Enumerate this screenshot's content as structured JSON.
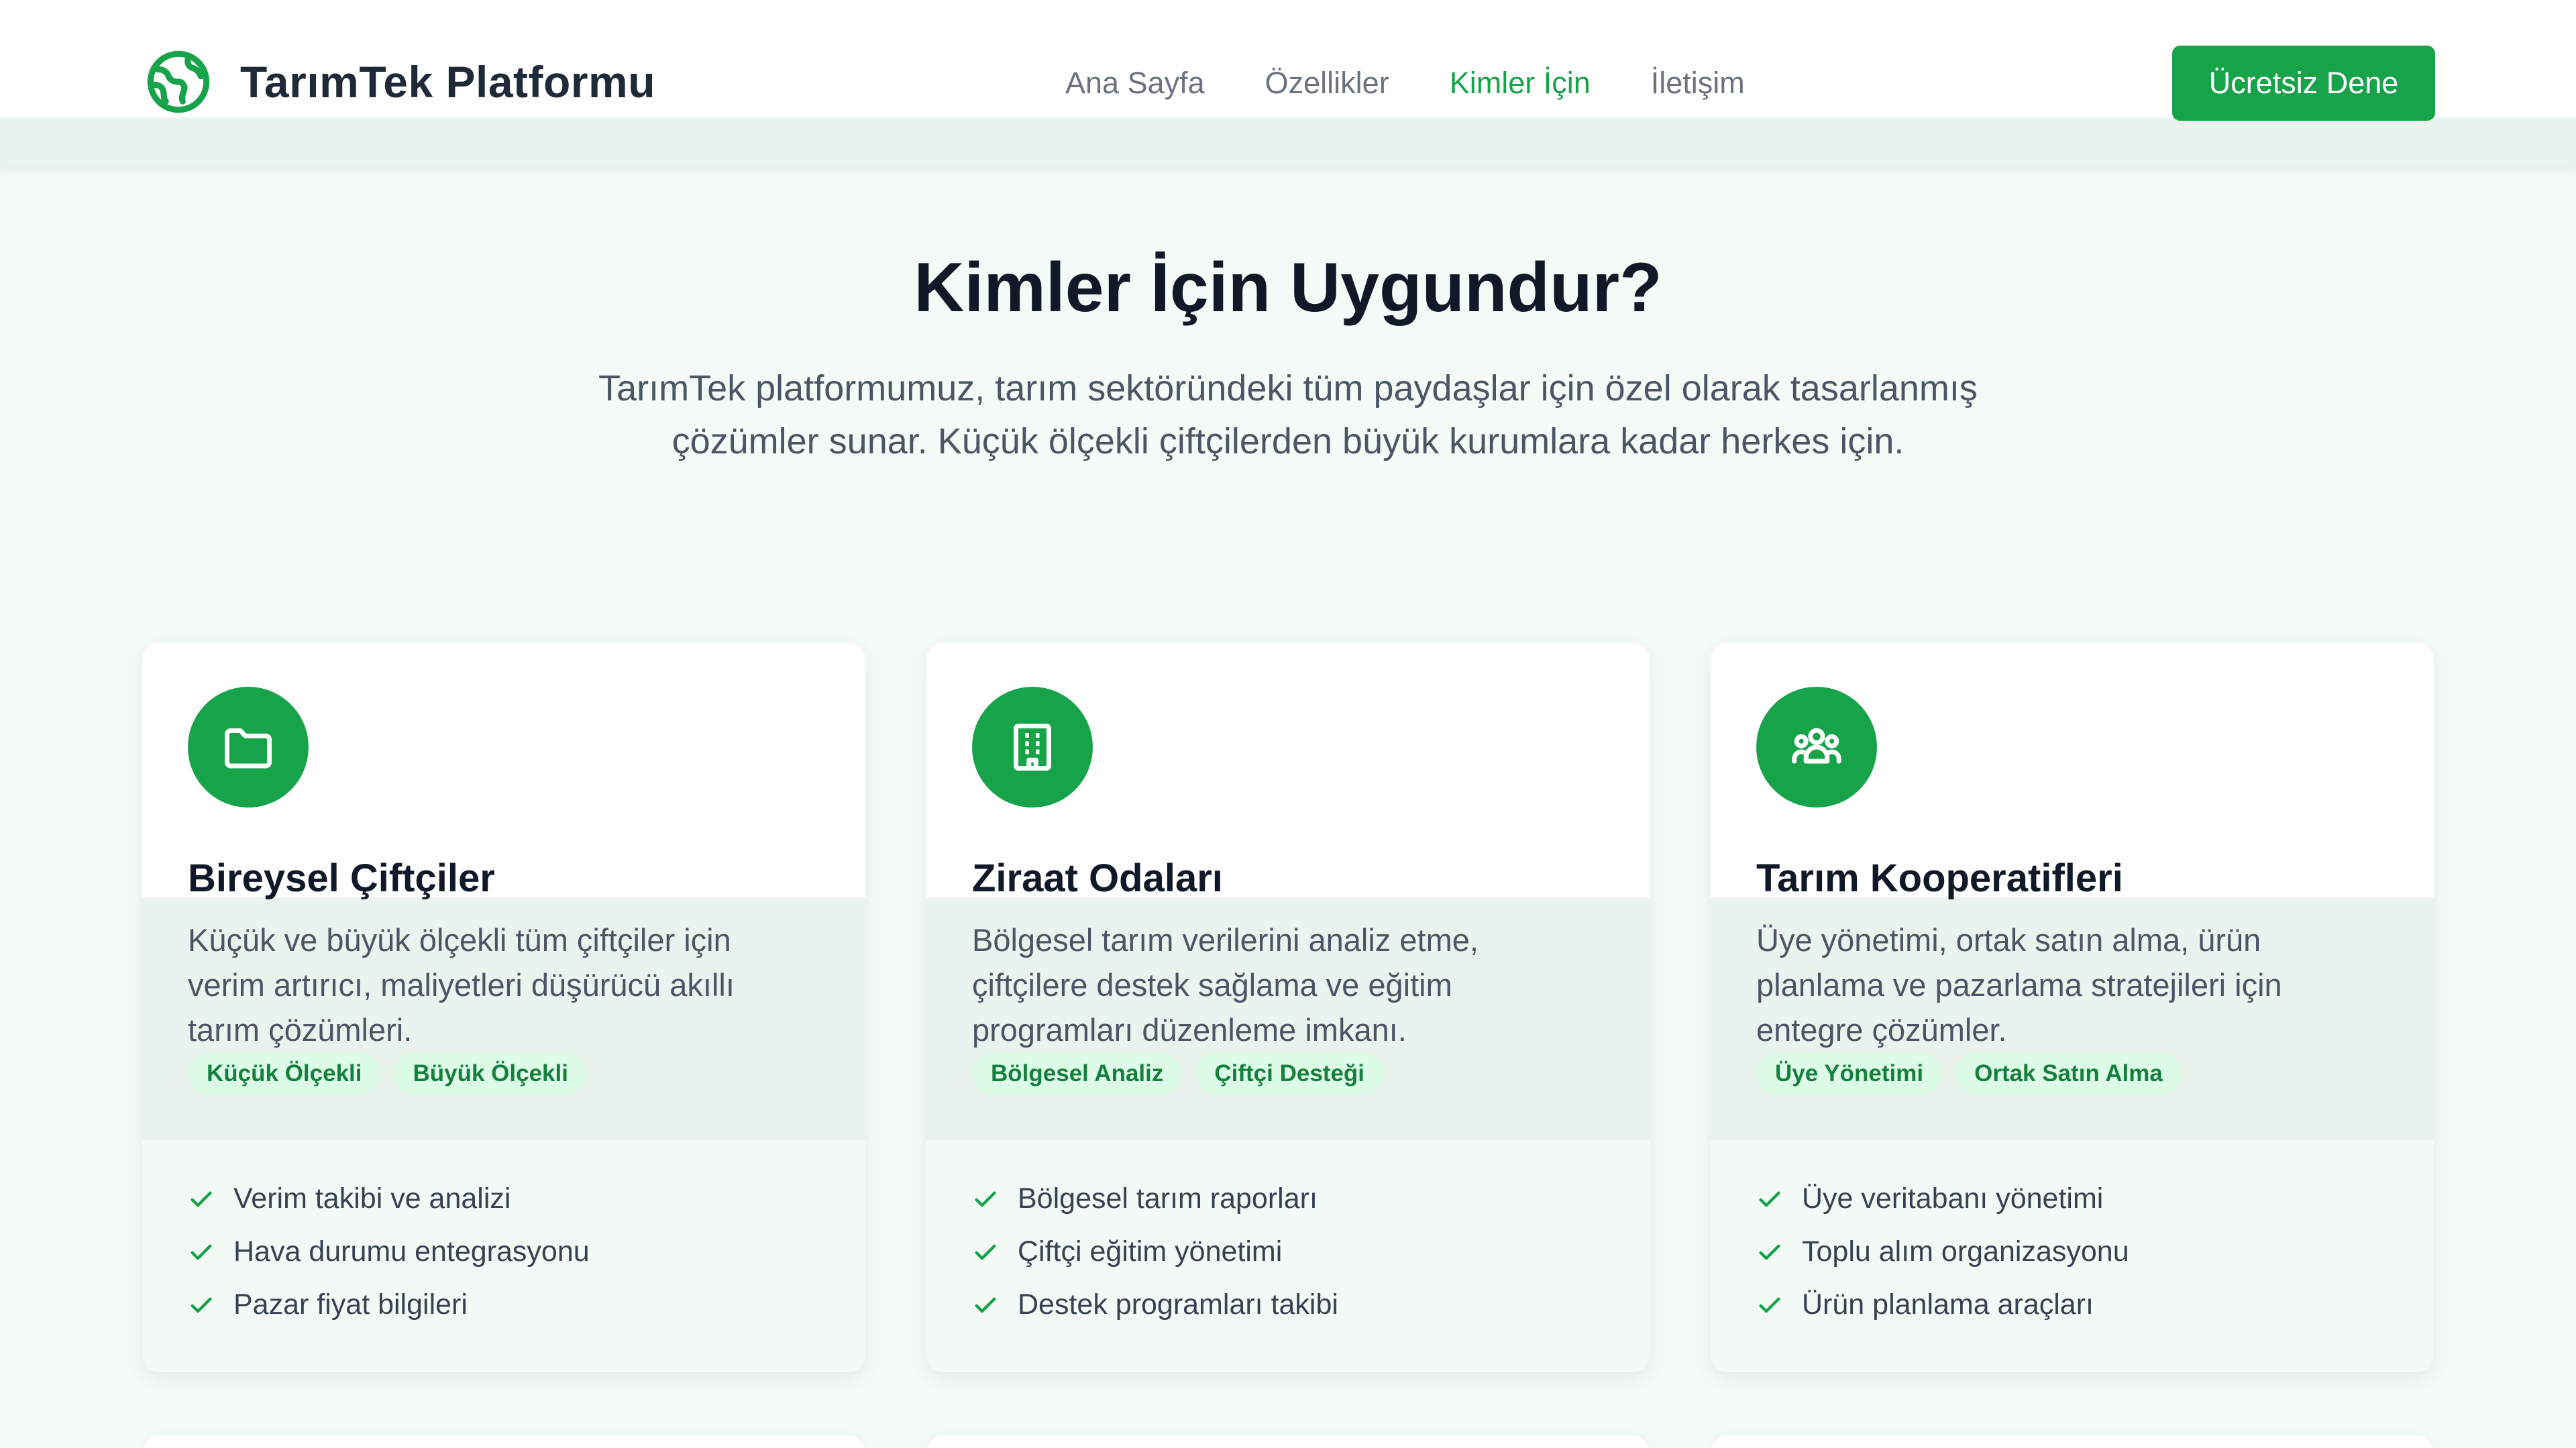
{
  "header": {
    "brand_name": "TarımTek Platformu",
    "logo_icon": "globe-leaf-icon",
    "nav": [
      {
        "label": "Ana Sayfa",
        "active": false
      },
      {
        "label": "Özellikler",
        "active": false
      },
      {
        "label": "Kimler İçin",
        "active": true
      },
      {
        "label": "İletişim",
        "active": false
      }
    ],
    "cta_label": "Ücretsiz Dene"
  },
  "hero": {
    "title": "Kimler İçin Uygundur?",
    "subtitle": "TarımTek platformumuz, tarım sektöründeki tüm paydaşlar için özel olarak tasarlanmış çözümler sunar. Küçük ölçekli çiftçilerden büyük kurumlara kadar herkes için."
  },
  "cards": [
    {
      "icon": "folder-icon",
      "title": "Bireysel Çiftçiler",
      "description": "Küçük ve büyük ölçekli tüm çiftçiler için verim artırıcı, maliyetleri düşürücü akıllı tarım çözümleri.",
      "tags": [
        "Küçük Ölçekli",
        "Büyük Ölçekli"
      ],
      "features": [
        "Verim takibi ve analizi",
        "Hava durumu entegrasyonu",
        "Pazar fiyat bilgileri"
      ]
    },
    {
      "icon": "building-icon",
      "title": "Ziraat Odaları",
      "description": "Bölgesel tarım verilerini analiz etme, çiftçilere destek sağlama ve eğitim programları düzenleme imkanı.",
      "tags": [
        "Bölgesel Analiz",
        "Çiftçi Desteği"
      ],
      "features": [
        "Bölgesel tarım raporları",
        "Çiftçi eğitim yönetimi",
        "Destek programları takibi"
      ]
    },
    {
      "icon": "users-group-icon",
      "title": "Tarım Kooperatifleri",
      "description": "Üye yönetimi, ortak satın alma, ürün planlama ve pazarlama stratejileri için entegre çözümler.",
      "tags": [
        "Üye Yönetimi",
        "Ortak Satın Alma"
      ],
      "features": [
        "Üye veritabanı yönetimi",
        "Toplu alım organizasyonu",
        "Ürün planlama araçları"
      ]
    }
  ],
  "colors": {
    "accent": "#16a34a",
    "background": "#f4fbf6",
    "tag_bg": "#dcfce7",
    "tag_text": "#15803d"
  }
}
